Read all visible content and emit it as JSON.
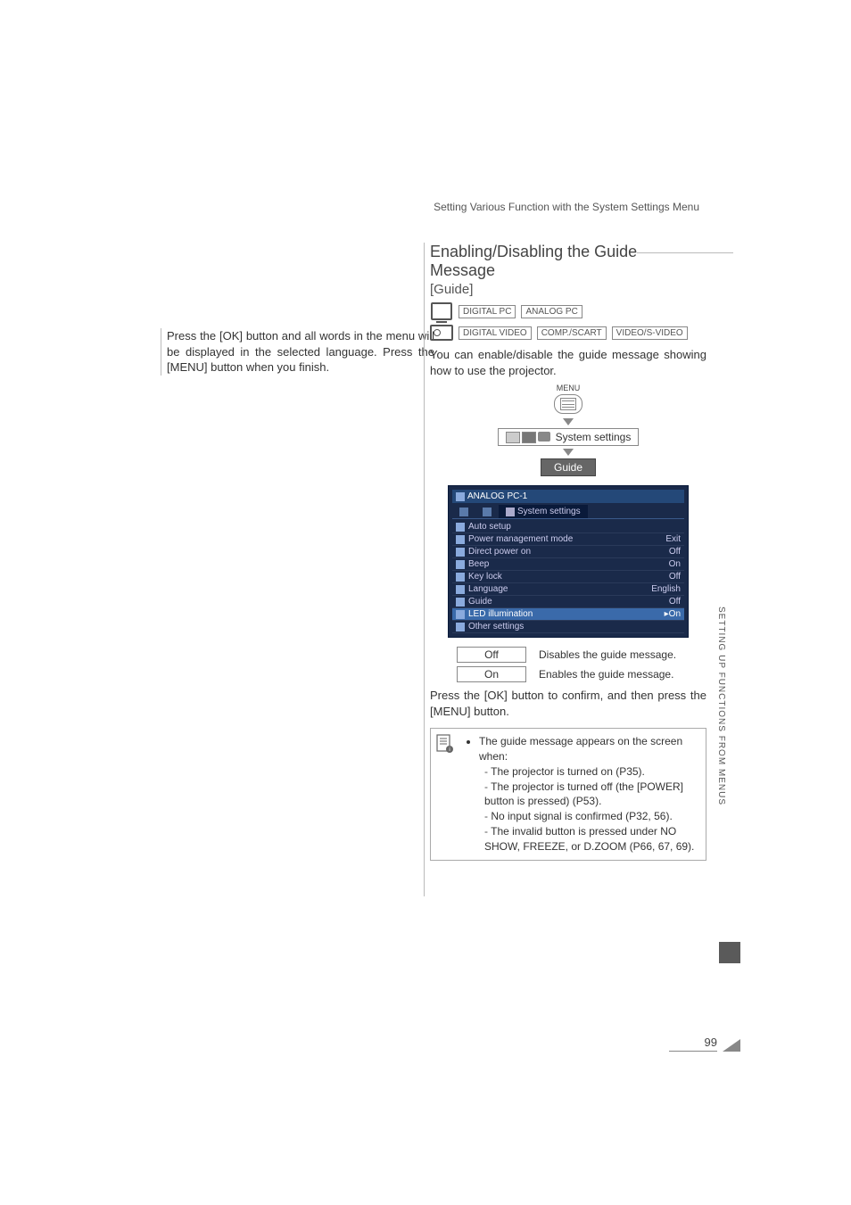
{
  "header": {
    "chapter": "Setting Various Function with the System Settings Menu"
  },
  "left": {
    "paragraph": "Press the [OK] button and all words in the menu will be displayed in the selected language. Press the [MENU] button when you finish."
  },
  "right": {
    "heading": "Enabling/Disabling the Guide Message",
    "subheading": "[Guide]",
    "input_row1": [
      "DIGITAL PC",
      "ANALOG PC"
    ],
    "input_row2": [
      "DIGITAL VIDEO",
      "COMP./SCART",
      "VIDEO/S-VIDEO"
    ],
    "intro": "You can enable/disable the guide message showing how to use the projector.",
    "flow": {
      "menu_label": "MENU",
      "step1": "System settings",
      "step2": "Guide"
    },
    "osd": {
      "title_input": "ANALOG PC-1",
      "tab_active": "System settings",
      "rows": [
        {
          "label": "Auto setup",
          "value": ""
        },
        {
          "label": "Power management mode",
          "value": "Exit"
        },
        {
          "label": "Direct power on",
          "value": "Off"
        },
        {
          "label": "Beep",
          "value": "On"
        },
        {
          "label": "Key lock",
          "value": "Off"
        },
        {
          "label": "Language",
          "value": "English"
        },
        {
          "label": "Guide",
          "value": "Off"
        },
        {
          "label": "LED illumination",
          "value": "▸On",
          "highlight": true
        },
        {
          "label": "Other settings",
          "value": ""
        }
      ]
    },
    "options": [
      {
        "key": "Off",
        "desc": "Disables the guide message."
      },
      {
        "key": "On",
        "desc": "Enables the guide message."
      }
    ],
    "confirm": "Press the [OK] button to confirm, and then press the [MENU] button.",
    "note": {
      "lead": "The guide message appears on the screen when:",
      "items": [
        "The projector is turned on (P35).",
        "The projector is turned off (the [POWER] button is pressed) (P53).",
        "No input signal is confirmed (P32, 56).",
        "The invalid button is pressed under NO SHOW, FREEZE, or D.ZOOM (P66, 67, 69)."
      ]
    }
  },
  "side": {
    "vertical": "SETTING UP FUNCTIONS FROM MENUS"
  },
  "page_number": "99"
}
